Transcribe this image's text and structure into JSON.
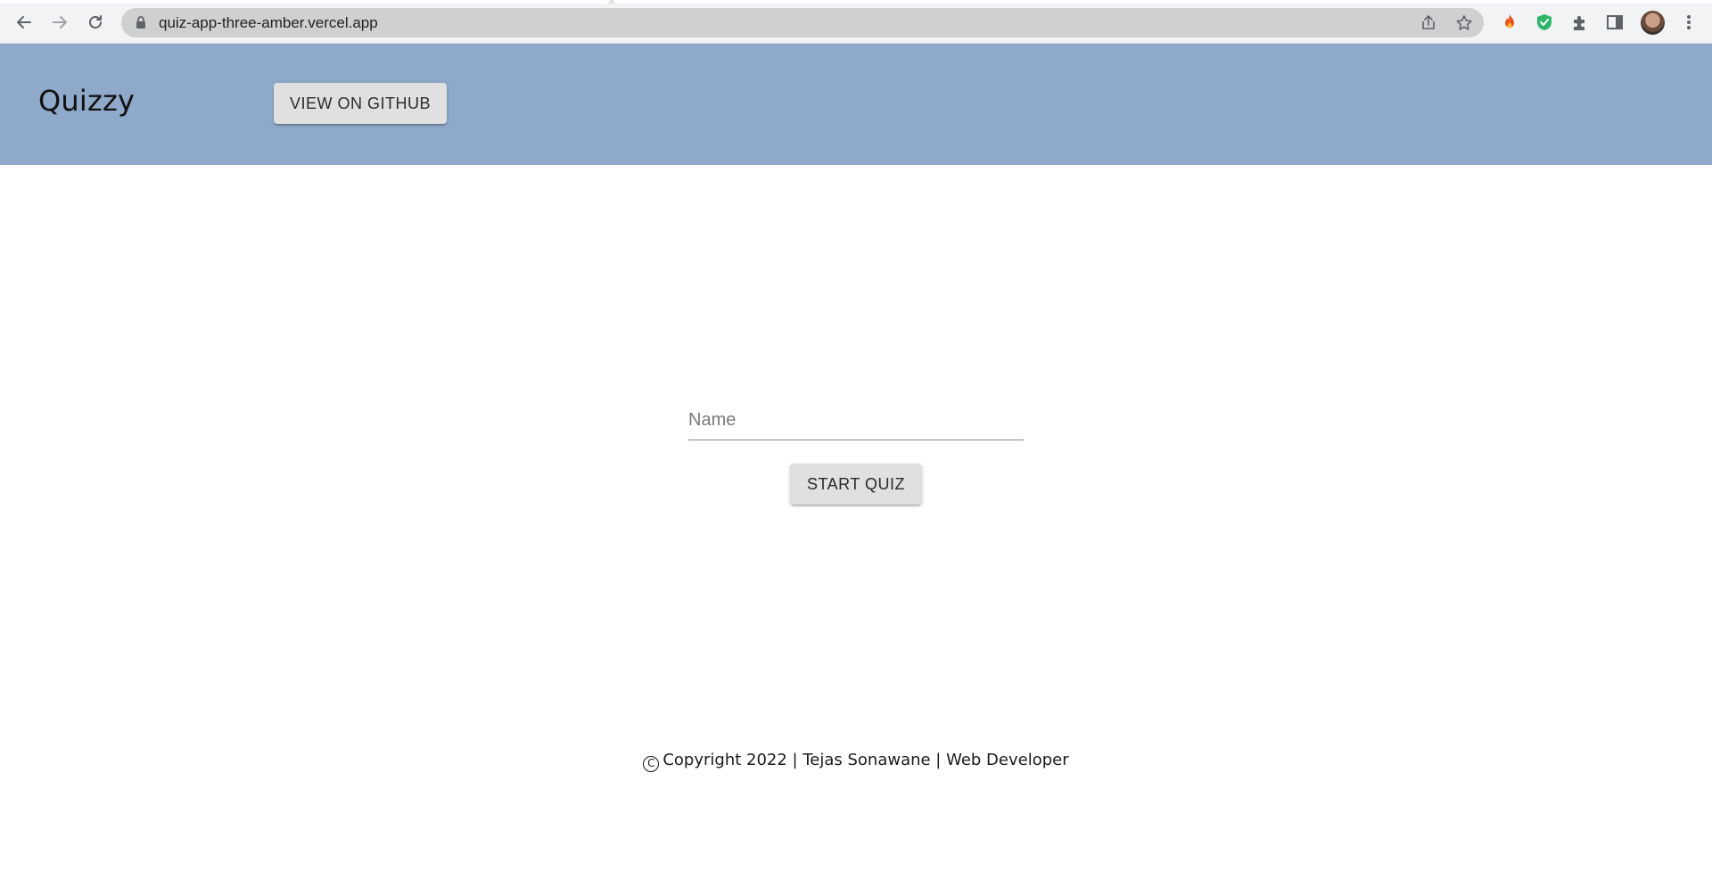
{
  "browser": {
    "url": "quiz-app-three-amber.vercel.app"
  },
  "header": {
    "brand": "Quizzy",
    "github_button_label": "VIEW ON GITHUB",
    "background_color": "#8fa9ca"
  },
  "form": {
    "name_placeholder": "Name",
    "name_value": "",
    "start_button_label": "START QUIZ"
  },
  "footer": {
    "copyright_symbol": "C",
    "text": "Copyright 2022 | Tejas Sonawane | Web Developer"
  }
}
